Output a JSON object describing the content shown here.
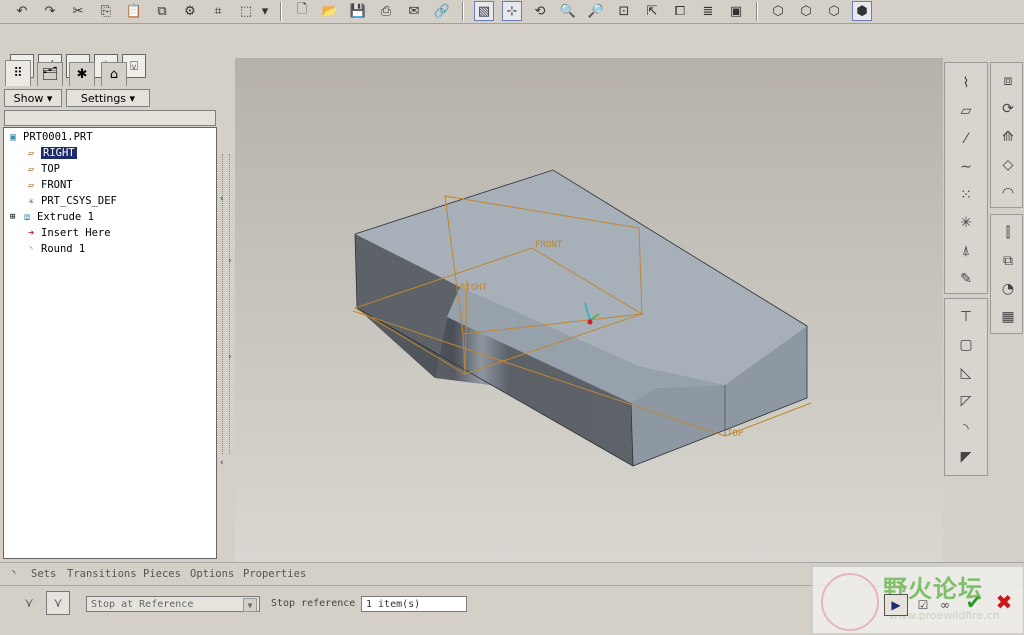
{
  "tree_root": "PRT0001.PRT",
  "tree_items": [
    {
      "label": "RIGHT"
    },
    {
      "label": "TOP"
    },
    {
      "label": "FRONT"
    },
    {
      "label": "PRT_CSYS_DEF"
    },
    {
      "label": "Extrude 1"
    },
    {
      "label": "Insert Here"
    },
    {
      "label": "Round 1"
    }
  ],
  "nav": {
    "show_label": "Show",
    "settings_label": "Settings"
  },
  "datum_labels": {
    "front": "FRONT",
    "right": "RIGHT",
    "top": "TOP"
  },
  "dashboard": {
    "tabs": [
      "Sets",
      "Transitions",
      "Pieces",
      "Options",
      "Properties"
    ],
    "mode_value": "Stop at Reference",
    "stop_ref_label": "Stop reference",
    "stop_ref_value": "1 item(s)"
  },
  "watermark": {
    "text": "野火论坛",
    "url": "www.proewildfire.cn"
  },
  "colors": {
    "accent_select": "#1c2b6e",
    "part": "#8e9aa4",
    "datum": "#c0862e"
  }
}
